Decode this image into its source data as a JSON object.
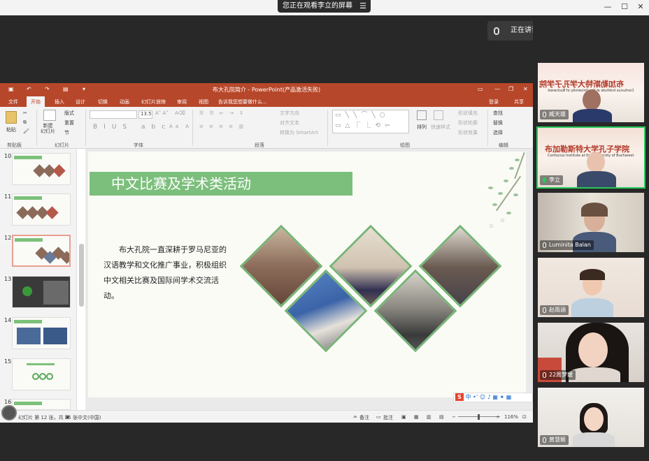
{
  "meeting": {
    "share_notice": "您正在观看李立的屏幕",
    "speaking_label": "正在讲话: 李立;"
  },
  "window": {
    "minimize": "—",
    "maximize": "☐",
    "close": "✕"
  },
  "ppt": {
    "title": "布大孔院简介 - PowerPoint(产品激活失败)",
    "tabs": [
      "文件",
      "开始",
      "插入",
      "设计",
      "切换",
      "动画",
      "幻灯片放映",
      "审阅",
      "视图"
    ],
    "tell_me": "告诉我您想要做什么...",
    "login": "登录",
    "share": "共享",
    "ribbon": {
      "paste": "粘贴",
      "cut": "剪切",
      "copy": "复制",
      "format": "格式刷",
      "new_slide": "新建\n幻灯片",
      "layout": "版式",
      "reset": "重置",
      "section": "节",
      "font_size": "13.5",
      "text_direction": "文字方向",
      "align_text": "对齐文本",
      "smartart": "转换为 SmartArt",
      "arrange": "排列",
      "quick_styles": "快速样式",
      "shape_fill": "形状填充",
      "shape_outline": "形状轮廓",
      "shape_effects": "形状效果",
      "find": "查找",
      "replace": "替换",
      "select": "选择",
      "groups": [
        "剪贴板",
        "幻灯片",
        "字体",
        "段落",
        "绘图",
        "编辑"
      ]
    },
    "thumb_numbers": [
      "10",
      "11",
      "12",
      "13",
      "14",
      "15",
      "16"
    ],
    "slide": {
      "title": "中文比赛及学术类活动",
      "body": "布大孔院一直深耕于罗马尼亚的汉语教学和文化推广事业，积极组织中文相关比赛及国际间学术交流活动。"
    },
    "status": {
      "slide_count": "幻灯片 第 12 张，共 25 张",
      "language": "中文(中国)",
      "notes": "备注",
      "comments": "批注",
      "zoom": "116%"
    },
    "ime": "中"
  },
  "participants": [
    {
      "name": "臧天雄",
      "banner": "布加勒斯特大学孔子学院",
      "banner_sub": "Confucius Institute at the University of Bucharest"
    },
    {
      "name": "李立",
      "banner": "布加勒斯特大学孔子学院",
      "banner_sub": "Confucius Institute at the University of Bucharest"
    },
    {
      "name": "Luminita Balan"
    },
    {
      "name": "赵雨涵"
    },
    {
      "name": "22周梦媛"
    },
    {
      "name": "黄慧颖"
    }
  ]
}
